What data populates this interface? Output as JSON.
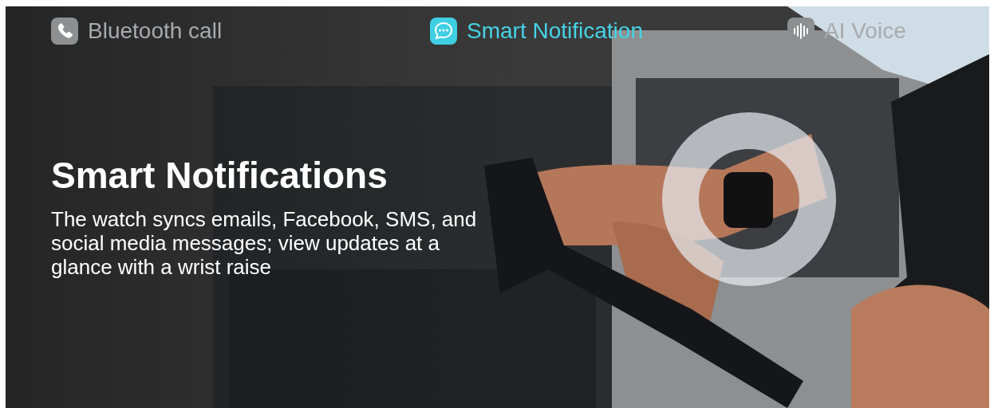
{
  "tabs": [
    {
      "label": "Bluetooth call",
      "kind": "phone",
      "selected": false
    },
    {
      "label": "Smart Notification",
      "kind": "chat",
      "selected": true
    },
    {
      "label": "AI Voice",
      "kind": "voice",
      "selected": false
    }
  ],
  "title": "Smart Notifications",
  "description": "The watch syncs emails, Facebook, SMS, and social media messages; view updates at a glance with a wrist raise"
}
